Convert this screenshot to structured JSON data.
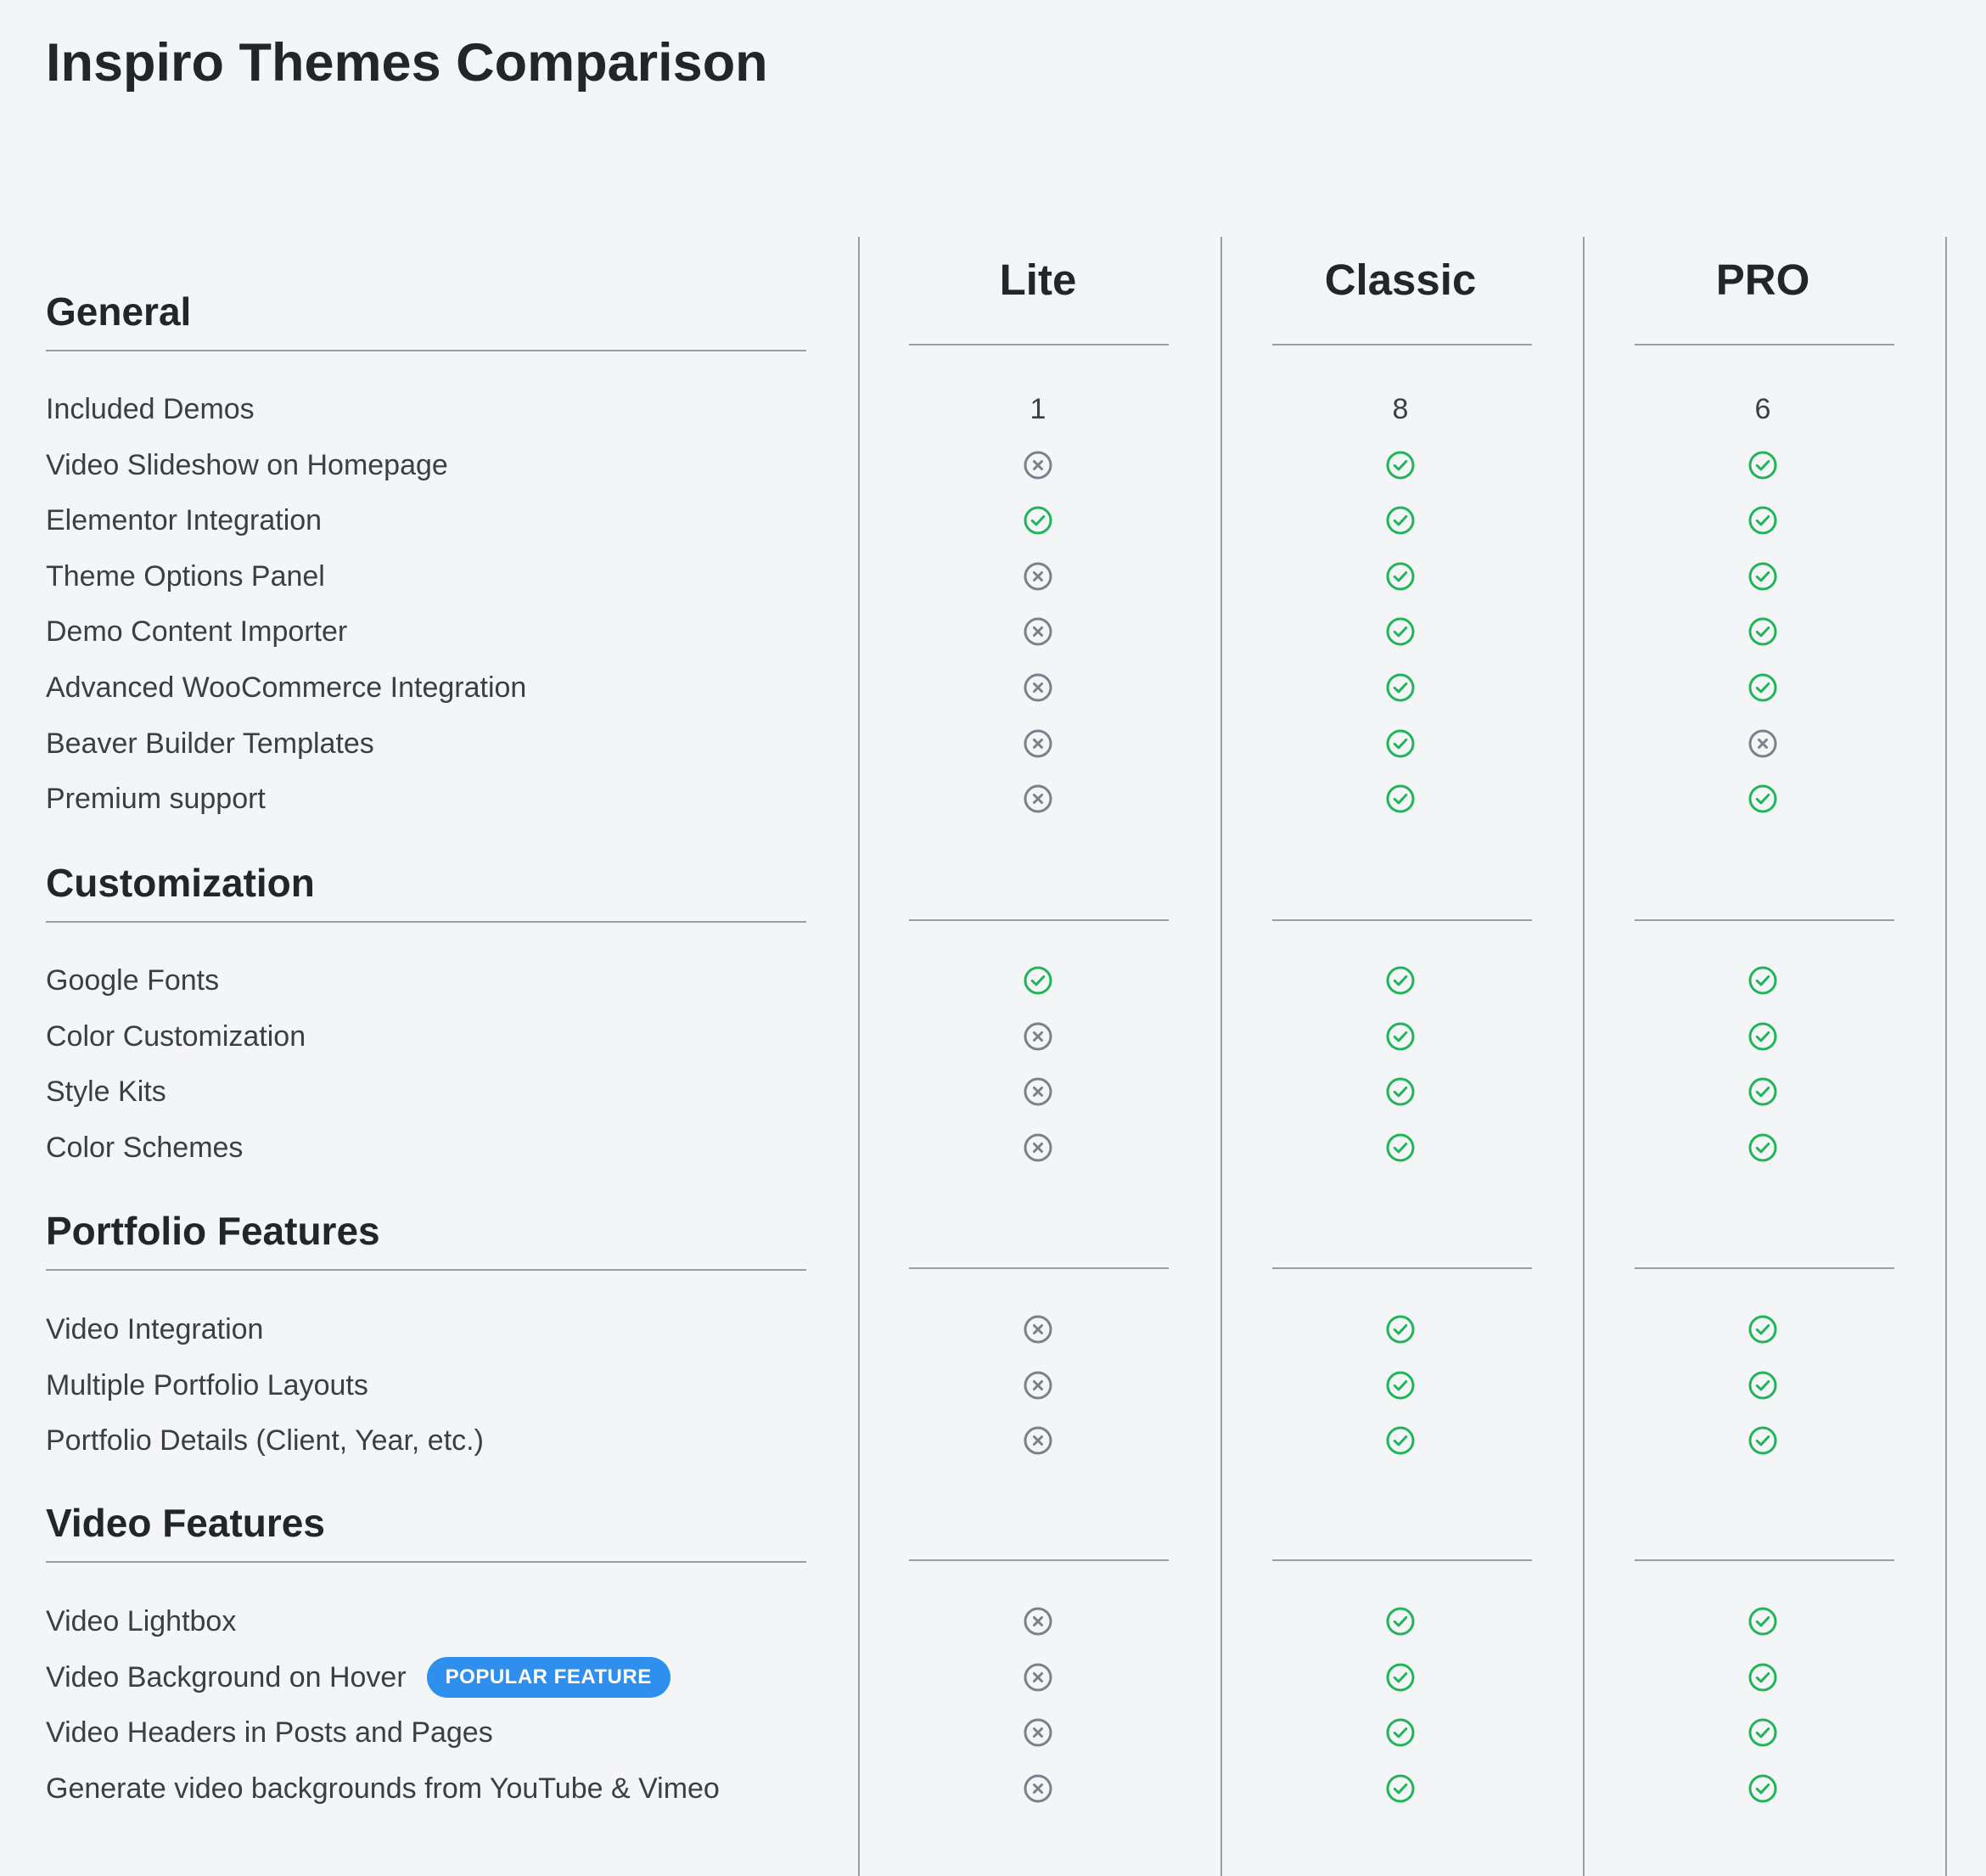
{
  "page": {
    "title": "Inspiro Themes Comparison"
  },
  "plans": [
    "Lite",
    "Classic",
    "PRO"
  ],
  "colors": {
    "check": "#22b45a",
    "cross": "#7b818a",
    "badge": "#2f8fef",
    "rule": "#9a9ea4",
    "background": "#f4f5f7"
  },
  "icons": {
    "yes": "check-circle-icon",
    "no": "x-circle-icon"
  },
  "sections": [
    {
      "title": "General",
      "features": [
        {
          "label": "Included Demos",
          "values": [
            "1",
            "8",
            "6"
          ]
        },
        {
          "label": "Video Slideshow on Homepage",
          "values": [
            "no",
            "yes",
            "yes"
          ]
        },
        {
          "label": "Elementor Integration",
          "values": [
            "yes",
            "yes",
            "yes"
          ]
        },
        {
          "label": "Theme Options Panel",
          "values": [
            "no",
            "yes",
            "yes"
          ]
        },
        {
          "label": "Demo Content Importer",
          "values": [
            "no",
            "yes",
            "yes"
          ]
        },
        {
          "label": "Advanced WooCommerce Integration",
          "values": [
            "no",
            "yes",
            "yes"
          ]
        },
        {
          "label": "Beaver Builder Templates",
          "values": [
            "no",
            "yes",
            "no"
          ]
        },
        {
          "label": "Premium support",
          "values": [
            "no",
            "yes",
            "yes"
          ]
        }
      ]
    },
    {
      "title": "Customization",
      "features": [
        {
          "label": "Google Fonts",
          "values": [
            "yes",
            "yes",
            "yes"
          ]
        },
        {
          "label": "Color Customization",
          "values": [
            "no",
            "yes",
            "yes"
          ]
        },
        {
          "label": "Style Kits",
          "values": [
            "no",
            "yes",
            "yes"
          ]
        },
        {
          "label": "Color Schemes",
          "values": [
            "no",
            "yes",
            "yes"
          ]
        }
      ]
    },
    {
      "title": "Portfolio Features",
      "features": [
        {
          "label": "Video Integration",
          "values": [
            "no",
            "yes",
            "yes"
          ]
        },
        {
          "label": "Multiple Portfolio Layouts",
          "values": [
            "no",
            "yes",
            "yes"
          ]
        },
        {
          "label": "Portfolio Details (Client, Year, etc.)",
          "values": [
            "no",
            "yes",
            "yes"
          ]
        }
      ]
    },
    {
      "title": "Video Features",
      "features": [
        {
          "label": "Video Lightbox",
          "values": [
            "no",
            "yes",
            "yes"
          ]
        },
        {
          "label": "Video Background on Hover",
          "badge": "POPULAR FEATURE",
          "values": [
            "no",
            "yes",
            "yes"
          ]
        },
        {
          "label": "Video Headers in Posts and Pages",
          "values": [
            "no",
            "yes",
            "yes"
          ]
        },
        {
          "label": "Generate video backgrounds from YouTube & Vimeo",
          "values": [
            "no",
            "yes",
            "yes"
          ]
        }
      ]
    }
  ]
}
